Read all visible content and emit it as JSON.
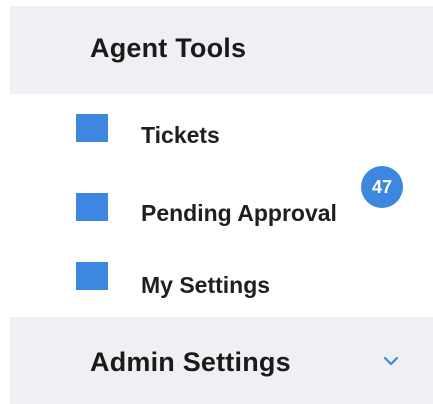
{
  "agent_tools": {
    "title": "Agent Tools",
    "items": [
      {
        "label": "Tickets"
      },
      {
        "label": "Pending Approval",
        "badge": "47"
      },
      {
        "label": "My Settings"
      }
    ]
  },
  "admin_settings": {
    "title": "Admin Settings",
    "expand_icon": "chevron-down-icon"
  },
  "colors": {
    "accent": "#3d87e0",
    "header_bg": "#eef0f3",
    "text": "#1f1f1f"
  }
}
